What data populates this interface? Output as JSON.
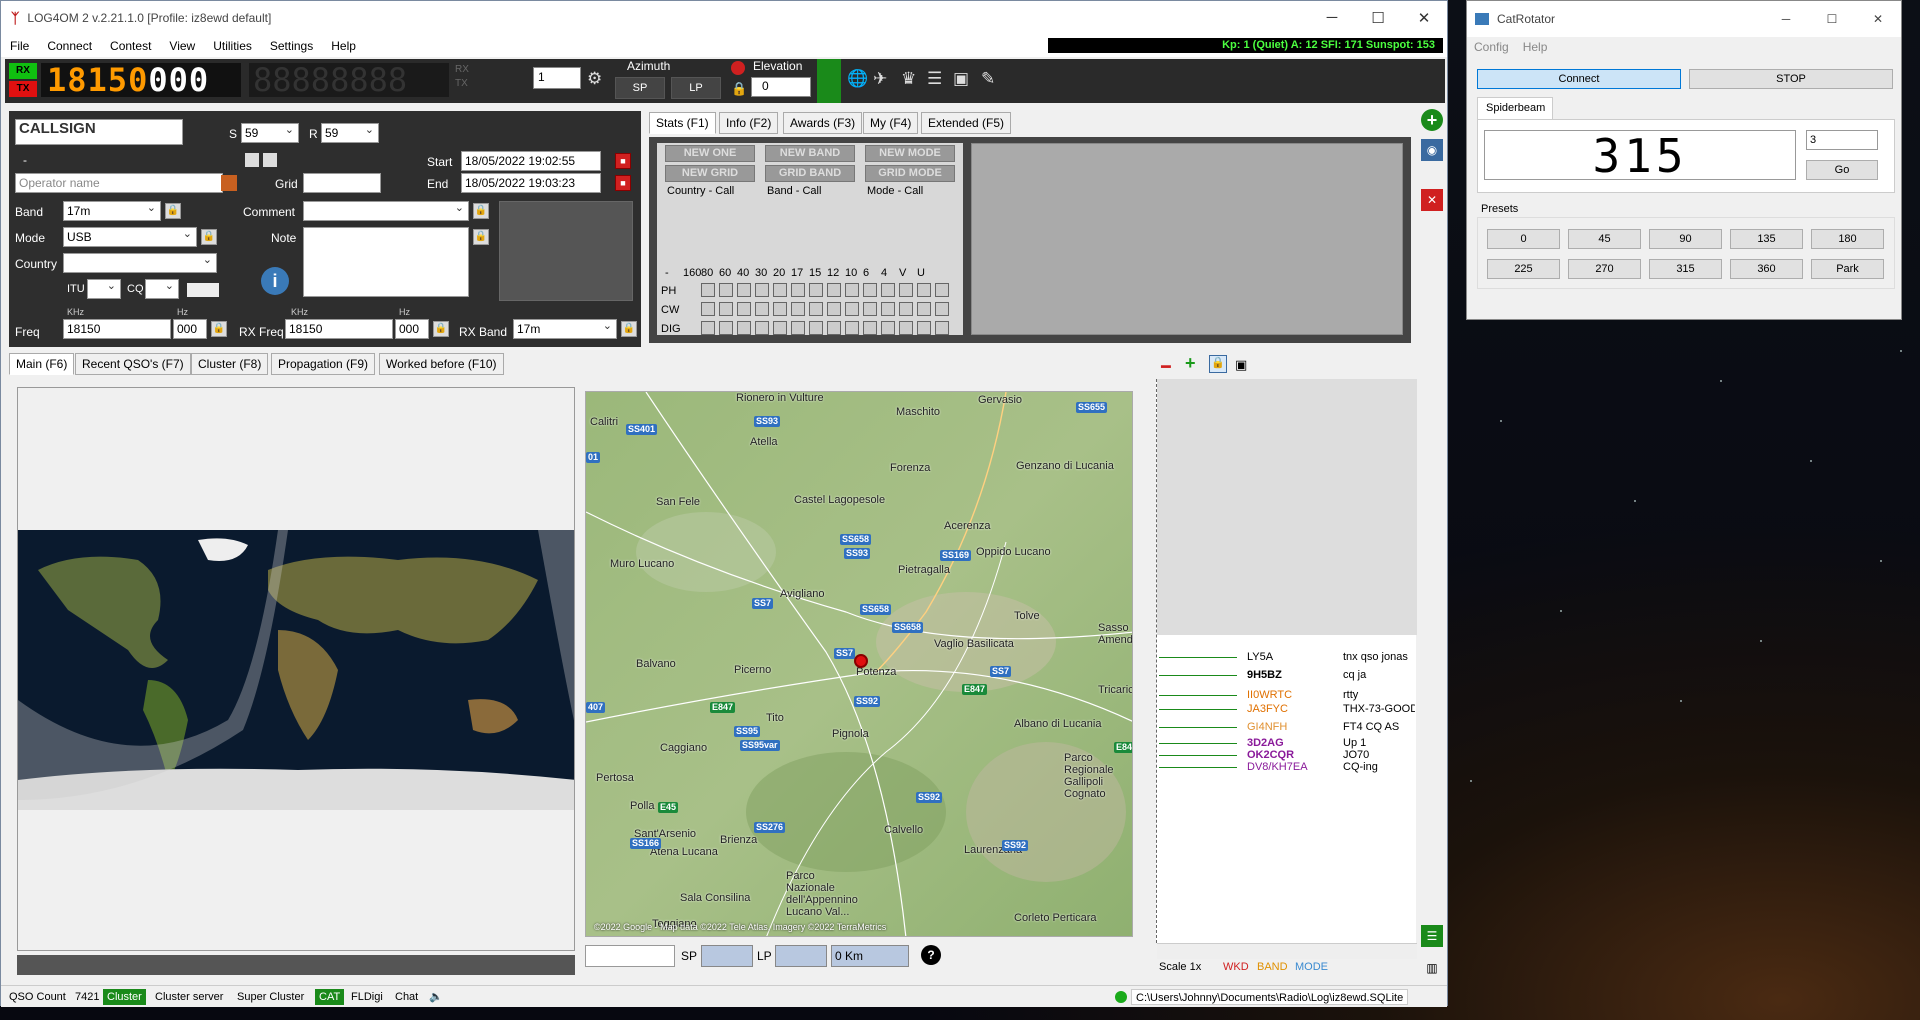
{
  "main": {
    "title": "LOG4OM 2 v.2.21.1.0 [Profile: iz8ewd default]",
    "menu": [
      "File",
      "Connect",
      "Contest",
      "View",
      "Utilities",
      "Settings",
      "Help"
    ],
    "kp_status": "Kp: 1 (Quiet)  A: 12  SFI: 171 Sunspot: 153"
  },
  "radio": {
    "rx": "RX",
    "tx": "TX",
    "freq_main": "18150",
    "freq_sub": "000",
    "freq_second": "88888888",
    "rx_small": "RX",
    "tx_small": "TX",
    "step": "1",
    "azimuth_label": "Azimuth",
    "sp": "SP",
    "lp": "LP",
    "elevation_label": "Elevation",
    "elevation_value": "0"
  },
  "qso": {
    "callsign_placeholder": "CALLSIGN",
    "s_label": "S",
    "s_value": "59",
    "r_label": "R",
    "r_value": "59",
    "dash": "-",
    "start_label": "Start",
    "start_value": "18/05/2022 19:02:55",
    "end_label": "End",
    "end_value": "18/05/2022 19:03:23",
    "operator_placeholder": "Operator name",
    "grid_label": "Grid",
    "band_label": "Band",
    "band_value": "17m",
    "comment_label": "Comment",
    "mode_label": "Mode",
    "mode_value": "USB",
    "note_label": "Note",
    "country_label": "Country",
    "itu_label": "ITU",
    "cq_label": "CQ",
    "khz": "KHz",
    "hz": "Hz",
    "freq_label": "Freq",
    "freq_khz": "18150",
    "freq_hz": "000",
    "rxfreq_label": "RX Freq",
    "rxfreq_khz": "18150",
    "rxfreq_hz": "000",
    "rxband_label": "RX Band",
    "rxband_value": "17m"
  },
  "stats": {
    "tabs": [
      "Stats (F1)",
      "Info (F2)",
      "Awards (F3)",
      "My (F4)",
      "Extended (F5)"
    ],
    "buttons": [
      "NEW ONE",
      "NEW BAND",
      "NEW MODE",
      "NEW GRID",
      "GRID BAND",
      "GRID MODE"
    ],
    "captions": [
      "Country - Call",
      "Band - Call",
      "Mode - Call"
    ],
    "bands": [
      "-",
      "160",
      "80",
      "60",
      "40",
      "30",
      "20",
      "17",
      "15",
      "12",
      "10",
      "6",
      "4",
      "V",
      "U"
    ],
    "rows": [
      "PH",
      "CW",
      "DIG"
    ]
  },
  "lower_tabs": [
    "Main (F6)",
    "Recent QSO's (F7)",
    "Cluster (F8)",
    "Propagation (F9)",
    "Worked before (F10)"
  ],
  "terrain": {
    "towns": [
      "Rionero in Vulture",
      "Maschito",
      "Gervasio",
      "Calitri",
      "Atella",
      "Forenza",
      "Genzano di Lucania",
      "San Fele",
      "Castel Lagopesole",
      "Acerenza",
      "Muro Lucano",
      "Oppido Lucano",
      "Pietragalla",
      "Avigliano",
      "Tolve",
      "Vaglio Basilicata",
      "Balvano",
      "Picerno",
      "Potenza",
      "Tricarico",
      "Tito",
      "Pignola",
      "Albano di Lucania",
      "Caggiano",
      "Pertosa",
      "Polla",
      "Parco Regionale Gallipoli Cognato",
      "Sant'Arsenio",
      "Atena Lucana",
      "Brienza",
      "Calvello",
      "Laurenzana",
      "Parco Nazionale dell'Appennino Lucano Val...",
      "Sala Consilina",
      "Teggiano",
      "Corleto Perticara",
      "Sasso Amendola"
    ],
    "roads": [
      "SS655",
      "SS93",
      "SS401",
      "SS658",
      "SS93",
      "SS169",
      "SS7",
      "SS658",
      "SS658",
      "SS7",
      "E847",
      "SS7",
      "E847",
      "SS92",
      "SS95",
      "SS95var",
      "E847",
      "SS92",
      "E45",
      "SS276",
      "SS166",
      "SS92",
      "407",
      "01"
    ],
    "copyright": "©2022 Google - Map data ©2022 Tele Atlas, Imagery ©2022 TerraMetrics",
    "sp_label": "SP",
    "lp_label": "LP",
    "distance": "0 Km"
  },
  "cluster": {
    "spots": [
      {
        "call": "LY5A",
        "msg": "tnx qso jonas",
        "color": "#000000"
      },
      {
        "call": "9H5BZ",
        "msg": "cq ja",
        "color": "#000000"
      },
      {
        "call": "II0WRTC",
        "msg": "rtty",
        "color": "#e07000"
      },
      {
        "call": "JA3FYC",
        "msg": "THX-73-GOOD",
        "color": "#e07000"
      },
      {
        "call": "GI4NFH",
        "msg": "FT4 CQ AS",
        "color": "#e09030"
      },
      {
        "call": "3D2AG",
        "msg": "Up 1",
        "color": "#8a1a9a"
      },
      {
        "call": "OK2CQR",
        "msg": "JO70",
        "color": "#8a1a9a"
      },
      {
        "call": "DV8/KH7EA",
        "msg": "CQ-ing",
        "color": "#8a1a9a"
      }
    ],
    "scale": "Scale 1x",
    "wkd": "WKD",
    "band": "BAND",
    "mode": "MODE"
  },
  "status": {
    "qso_count_label": "QSO Count",
    "qso_count": "7421",
    "cluster": "Cluster",
    "cluster_server": "Cluster server",
    "super_cluster": "Super Cluster",
    "cat": "CAT",
    "fldigi": "FLDigi",
    "chat": "Chat",
    "db_path": "C:\\Users\\Johnny\\Documents\\Radio\\Log\\iz8ewd.SQLite"
  },
  "rotator": {
    "title": "CatRotator",
    "menu": [
      "Config",
      "Help"
    ],
    "connect": "Connect",
    "stop": "STOP",
    "tab": "Spiderbeam",
    "heading": "315",
    "speed": "3",
    "go": "Go",
    "presets_label": "Presets",
    "presets": [
      "0",
      "45",
      "90",
      "135",
      "180",
      "225",
      "270",
      "315",
      "360",
      "Park"
    ]
  },
  "colors": {
    "accent_green": "#10c010",
    "freq_orange": "#ff9a00",
    "kp_green": "#4cff40",
    "status_cat": "#1a8a1a"
  }
}
